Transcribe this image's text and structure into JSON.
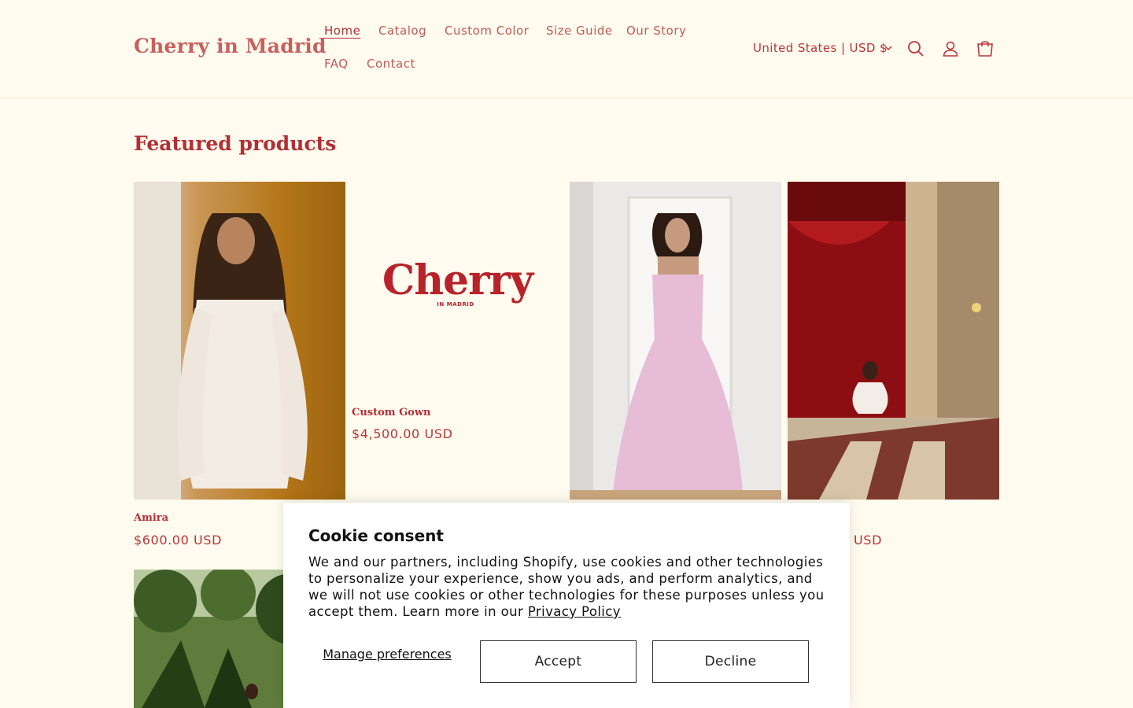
{
  "brand": {
    "name": "Cherry in Madrid"
  },
  "nav": {
    "items": [
      {
        "label": "Home",
        "active": true
      },
      {
        "label": "Catalog"
      },
      {
        "label": "Custom Color"
      },
      {
        "label": "Size Guide"
      },
      {
        "label": "Our Story"
      },
      {
        "label": "FAQ"
      },
      {
        "label": "Contact"
      }
    ]
  },
  "header": {
    "country": "United States | USD $",
    "icons": [
      "search-icon",
      "account-icon",
      "cart-icon"
    ]
  },
  "section": {
    "title": "Featured products"
  },
  "products": [
    {
      "name": "Amira",
      "price": "$600.00 USD"
    },
    {
      "name": "Custom Gown",
      "price": "$4,500.00 USD",
      "logo_text": "Cherry",
      "logo_subtext": "IN MADRID"
    },
    {
      "name": "",
      "price": ""
    },
    {
      "name": "",
      "price": "USD"
    }
  ],
  "cookie": {
    "title": "Cookie consent",
    "text": "We and our partners, including Shopify, use cookies and other technologies to personalize your experience, show you ads, and perform analytics, and we will not use cookies or other technologies for these purposes unless you accept them. Learn more in our",
    "link": "Privacy Policy",
    "manage": "Manage preferences",
    "accept": "Accept",
    "decline": "Decline"
  },
  "colors": {
    "background": "#fffbee",
    "accent": "#b22f36",
    "logo": "#c9605e"
  }
}
